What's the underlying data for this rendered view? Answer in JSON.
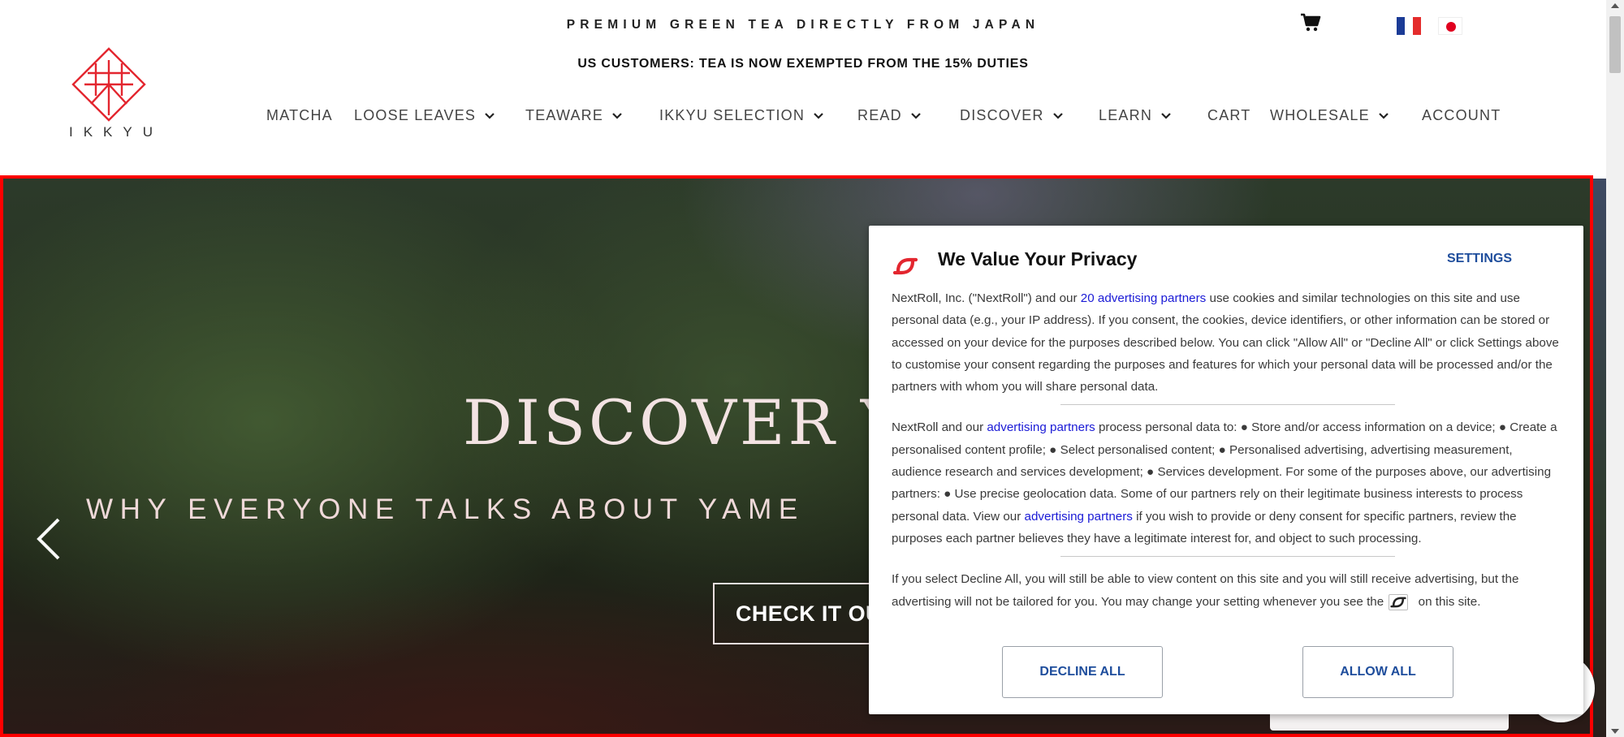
{
  "header": {
    "tagline": "PREMIUM GREEN TEA DIRECTLY FROM JAPAN",
    "announcement": "US CUSTOMERS: TEA IS NOW EXEMPTED FROM THE 15% DUTIES",
    "logo_text": "IKKYU",
    "cart_icon": "cart-icon",
    "languages": [
      "fr-flag",
      "jp-flag"
    ],
    "brand_color": "#e3262f"
  },
  "nav": {
    "items": [
      {
        "label": "MATCHA",
        "dropdown": false
      },
      {
        "label": "LOOSE LEAVES",
        "dropdown": true
      },
      {
        "label": "TEAWARE",
        "dropdown": true
      },
      {
        "label": "IKKYU SELECTION",
        "dropdown": true
      },
      {
        "label": "READ",
        "dropdown": true
      },
      {
        "label": "DISCOVER",
        "dropdown": true
      },
      {
        "label": "LEARN",
        "dropdown": true
      },
      {
        "label": "CART",
        "dropdown": false
      },
      {
        "label": "WHOLESALE",
        "dropdown": true
      },
      {
        "label": "ACCOUNT",
        "dropdown": false
      }
    ]
  },
  "hero": {
    "title": "DISCOVER YAME",
    "subtitle": "WHY EVERYONE TALKS ABOUT YAME",
    "cta": "CHECK IT OUT",
    "prev_icon": "chevron-left-icon"
  },
  "consent": {
    "title": "We Value Your Privacy",
    "settings": "SETTINGS",
    "p1": {
      "before": "NextRoll, Inc. (\"NextRoll\") and our ",
      "link": "20 advertising partners",
      "after": " use cookies and similar technologies on this site and use personal data (e.g., your IP address). If you consent, the cookies, device identifiers, or other information can be stored or accessed on your device for the purposes described below. You can click \"Allow All\" or \"Decline All\" or click Settings above to customise your consent regarding the purposes and features for which your personal data will be processed and/or the partners with whom you will share personal data."
    },
    "p2": {
      "before": "NextRoll and our ",
      "link1": "advertising partners",
      "middle": " process personal data to: ● Store and/or access information on a device; ● Create a personalised content profile; ● Select personalised content; ● Personalised advertising, advertising measurement, audience research and services development; ● Services development. For some of the purposes above, our advertising partners: ● Use precise geolocation data. Some of our partners rely on their legitimate business interests to process personal data. View our ",
      "link2": "advertising partners",
      "after": " if you wish to provide or deny consent for specific partners, review the purposes each partner believes they have a legitimate interest for, and object to such processing."
    },
    "p3": {
      "before": "If you select Decline All, you will still be able to view content on this site and you will still receive advertising, but the advertising will not be tailored for you. You may change your setting whenever you see the ",
      "after": " on this site."
    },
    "decline": "DECLINE ALL",
    "allow": "ALLOW ALL",
    "accent_color": "#1e4d9c",
    "link_color": "#1a1ad6"
  }
}
